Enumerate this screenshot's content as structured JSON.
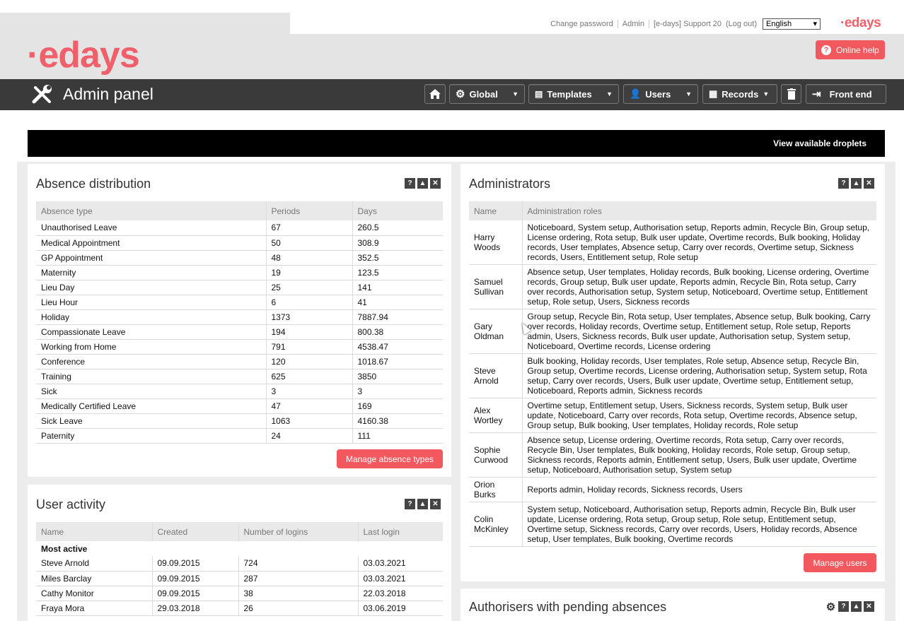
{
  "toplinks": {
    "change_password": "Change password",
    "admin": "Admin",
    "support": "[e-days] Support 20",
    "logout": "(Log out)",
    "language": "English"
  },
  "brand": {
    "small_logo": "·edays",
    "big_logo": "·edays",
    "accent": "#f2595e"
  },
  "help_button": "Online help",
  "admin_title": "Admin panel",
  "nav": {
    "global": "Global",
    "templates": "Templates",
    "users": "Users",
    "records": "Records",
    "front_end": "Front end"
  },
  "droplets_link": "View available droplets",
  "absence": {
    "title": "Absence distribution",
    "headers": [
      "Absence type",
      "Periods",
      "Days"
    ],
    "rows": [
      [
        "Unauthorised Leave",
        "67",
        "260.5"
      ],
      [
        "Medical Appointment",
        "50",
        "308.9"
      ],
      [
        "GP Appointment",
        "48",
        "352.5"
      ],
      [
        "Maternity",
        "19",
        "123.5"
      ],
      [
        "Lieu Day",
        "25",
        "141"
      ],
      [
        "Lieu Hour",
        "6",
        "41"
      ],
      [
        "Holiday",
        "1373",
        "7887.94"
      ],
      [
        "Compassionate Leave",
        "194",
        "800.38"
      ],
      [
        "Working from Home",
        "791",
        "4538.47"
      ],
      [
        "Conference",
        "120",
        "1018.67"
      ],
      [
        "Training",
        "625",
        "3850"
      ],
      [
        "Sick",
        "3",
        "3"
      ],
      [
        "Medically Certified Leave",
        "47",
        "169"
      ],
      [
        "Sick Leave",
        "1063",
        "4160.38"
      ],
      [
        "Paternity",
        "24",
        "111"
      ]
    ],
    "button": "Manage absence types"
  },
  "activity": {
    "title": "User activity",
    "headers": [
      "Name",
      "Created",
      "Number of logins",
      "Last login"
    ],
    "section": "Most active",
    "rows": [
      [
        "Steve Arnold",
        "09.09.2015",
        "724",
        "03.03.2021"
      ],
      [
        "Miles Barclay",
        "09.09.2015",
        "287",
        "03.03.2021"
      ],
      [
        "Cathy Monitor",
        "09.09.2015",
        "38",
        "22.03.2018"
      ],
      [
        "Fraya Mora",
        "29.03.2018",
        "26",
        "03.06.2019"
      ]
    ]
  },
  "administrators": {
    "title": "Administrators",
    "headers": [
      "Name",
      "Administration roles"
    ],
    "rows": [
      [
        "Harry Woods",
        "Noticeboard, System setup, Authorisation setup, Reports admin, Recycle Bin, Group setup, License ordering, Rota setup, Bulk user update, Overtime records, Bulk booking, Holiday records, User templates, Absence setup, Carry over records, Overtime setup, Sickness records, Users, Entitlement setup, Role setup"
      ],
      [
        "Samuel Sullivan",
        "Absence setup, User templates, Holiday records, Bulk booking, License ordering, Overtime records, Group setup, Bulk user update, Reports admin, Recycle Bin, Rota setup, Carry over records, Authorisation setup, System setup, Noticeboard, Overtime setup, Entitlement setup, Role setup, Users, Sickness records"
      ],
      [
        "Gary Oldman",
        "Group setup, Recycle Bin, Rota setup, User templates, Absence setup, Bulk booking, Carry over records, Holiday records, Overtime setup, Entitlement setup, Role setup, Reports admin, Users, Sickness records, Bulk user update, Authorisation setup, System setup, Noticeboard, Overtime records, License ordering"
      ],
      [
        "Steve Arnold",
        "Bulk booking, Holiday records, User templates, Role setup, Absence setup, Recycle Bin, Group setup, Overtime records, License ordering, Authorisation setup, System setup, Rota setup, Carry over records, Users, Bulk user update, Overtime setup, Entitlement setup, Noticeboard, Reports admin, Sickness records"
      ],
      [
        "Alex Wortley",
        "Overtime setup, Entitlement setup, Users, Sickness records, System setup, Bulk user update, Noticeboard, Carry over records, Rota setup, Overtime records, Absence setup, Group setup, Bulk booking, User templates, Holiday records, Role setup"
      ],
      [
        "Sophie Curwood",
        "Absence setup, License ordering, Overtime records, Rota setup, Carry over records, Recycle Bin, User templates, Bulk booking, Holiday records, Role setup, Group setup, Sickness records, Reports admin, Entitlement setup, Users, Bulk user update, Overtime setup, Noticeboard, Authorisation setup, System setup"
      ],
      [
        "Orion Burks",
        "Reports admin, Holiday records, Sickness records, Users"
      ],
      [
        "Colin McKinley",
        "System setup, Noticeboard, Authorisation setup, Reports admin, Recycle Bin, Bulk user update, License ordering, Rota setup, Group setup, Role setup, Entitlement setup, Overtime setup, Sickness records, Carry over records, Users, Holiday records, Absence setup, User templates, Bulk booking, Overtime records"
      ]
    ],
    "button": "Manage users"
  },
  "authorisers": {
    "title": "Authorisers with pending absences"
  }
}
